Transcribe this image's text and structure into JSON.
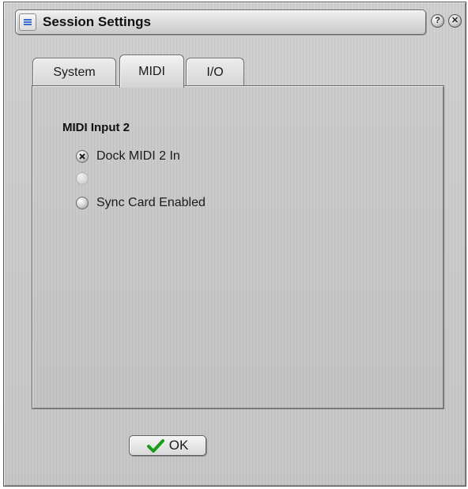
{
  "window": {
    "title": "Session Settings"
  },
  "titlebar": {
    "menu_icon": "menu-icon",
    "help_label": "?",
    "close_label": "✕"
  },
  "tabs": [
    {
      "label": "System",
      "active": false
    },
    {
      "label": "MIDI",
      "active": true
    },
    {
      "label": "I/O",
      "active": false
    }
  ],
  "panel": {
    "section_title": "MIDI Input 2",
    "options": [
      {
        "label": "Dock MIDI 2 In",
        "selected": true,
        "enabled": true
      },
      {
        "label": "",
        "selected": false,
        "enabled": false
      },
      {
        "label": "Sync Card Enabled",
        "selected": false,
        "enabled": true
      }
    ]
  },
  "footer": {
    "ok_label": "OK",
    "ok_icon": "checkmark-icon"
  },
  "colors": {
    "checkmark": "#1a9a1a",
    "menu_icon": "#3a6fd0"
  }
}
